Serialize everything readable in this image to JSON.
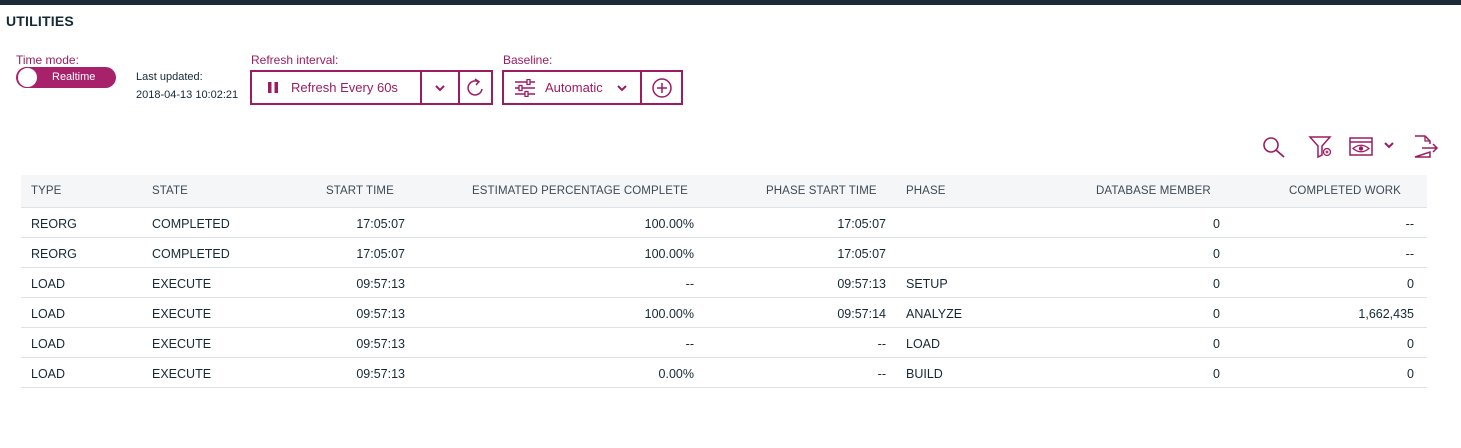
{
  "page_title": "UTILITIES",
  "time_mode": {
    "label": "Time mode:",
    "toggle_label": "Realtime"
  },
  "last_updated": {
    "label": "Last updated:",
    "value": "2018-04-13 10:02:21"
  },
  "refresh": {
    "label": "Refresh interval:",
    "button_label": "Refresh Every 60s"
  },
  "baseline": {
    "label": "Baseline:",
    "button_label": "Automatic"
  },
  "toolbar_icons": [
    "search-icon",
    "filter-icon",
    "view-icon",
    "chevron-down-icon",
    "export-icon"
  ],
  "colors": {
    "accent": "#9b1c61",
    "header_bg": "#f4f6f7",
    "topbar": "#1d2b36"
  },
  "table": {
    "columns": [
      "TYPE",
      "STATE",
      "START TIME",
      "ESTIMATED PERCENTAGE COMPLETE",
      "PHASE START TIME",
      "PHASE",
      "DATABASE MEMBER",
      "COMPLETED WORK"
    ],
    "rows": [
      [
        "REORG",
        "COMPLETED",
        "17:05:07",
        "100.00%",
        "17:05:07",
        "",
        "0",
        "--"
      ],
      [
        "REORG",
        "COMPLETED",
        "17:05:07",
        "100.00%",
        "17:05:07",
        "",
        "0",
        "--"
      ],
      [
        "LOAD",
        "EXECUTE",
        "09:57:13",
        "--",
        "09:57:13",
        "SETUP",
        "0",
        "0"
      ],
      [
        "LOAD",
        "EXECUTE",
        "09:57:13",
        "100.00%",
        "09:57:14",
        "ANALYZE",
        "0",
        "1,662,435"
      ],
      [
        "LOAD",
        "EXECUTE",
        "09:57:13",
        "--",
        "--",
        "LOAD",
        "0",
        "0"
      ],
      [
        "LOAD",
        "EXECUTE",
        "09:57:13",
        "0.00%",
        "--",
        "BUILD",
        "0",
        "0"
      ]
    ]
  }
}
